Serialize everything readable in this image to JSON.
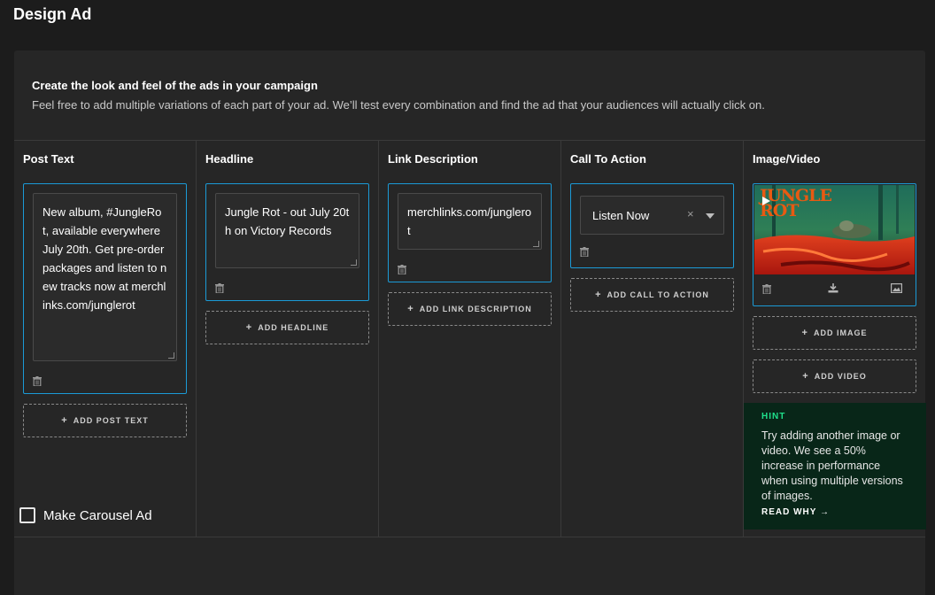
{
  "page": {
    "title": "Design Ad"
  },
  "intro": {
    "title": "Create the look and feel of the ads in your campaign",
    "text": "Feel free to add multiple variations of each part of your ad. We’ll test every combination and find the ad that your audiences will actually click on."
  },
  "columns": {
    "post_text": {
      "title": "Post Text",
      "value": "New album, #JungleRot, available everywhere July 20th. Get pre-order packages and listen to new tracks now at merchlinks.com/junglerot",
      "add_label": "ADD POST TEXT"
    },
    "headline": {
      "title": "Headline",
      "value": "Jungle Rot - out July 20th on Victory Records",
      "add_label": "ADD HEADLINE"
    },
    "link_description": {
      "title": "Link Description",
      "value": "merchlinks.com/junglerot",
      "add_label": "ADD LINK DESCRIPTION"
    },
    "call_to_action": {
      "title": "Call To Action",
      "selected": "Listen Now",
      "clear_glyph": "×",
      "add_label": "ADD CALL TO ACTION"
    },
    "media": {
      "title": "Image/Video",
      "thumb_logo": "JUNGLE ROT",
      "add_image_label": "ADD IMAGE",
      "add_video_label": "ADD VIDEO",
      "hint": {
        "label": "HINT",
        "text": "Try adding another image or video. We see a 50% increase in performance when using multiple versions of images.",
        "link": "READ WHY →"
      }
    }
  },
  "carousel": {
    "label": "Make Carousel Ad",
    "checked": false
  },
  "icons": {
    "plus": "+",
    "trash": "trash-icon",
    "download": "download-icon",
    "image": "image-icon",
    "play": "play-icon"
  },
  "colors": {
    "accent": "#1b9ad6",
    "hint_green": "#1fe08b",
    "hint_bg": "#082618"
  }
}
